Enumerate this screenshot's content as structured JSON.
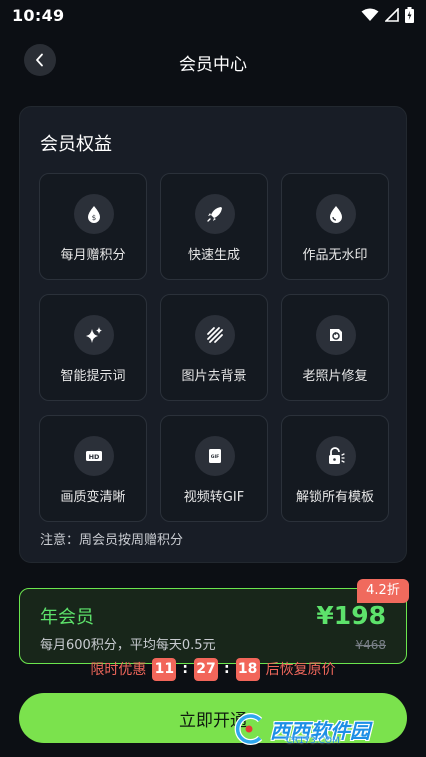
{
  "status_bar": {
    "time": "10:49"
  },
  "header": {
    "title": "会员中心"
  },
  "benefits": {
    "title": "会员权益",
    "items": [
      {
        "label": "每月赠积分",
        "icon": "coin-drop-icon"
      },
      {
        "label": "快速生成",
        "icon": "rocket-icon"
      },
      {
        "label": "作品无水印",
        "icon": "water-drop-icon"
      },
      {
        "label": "智能提示词",
        "icon": "sparkle-icon"
      },
      {
        "label": "图片去背景",
        "icon": "stripes-icon"
      },
      {
        "label": "老照片修复",
        "icon": "photo-restore-icon"
      },
      {
        "label": "画质变清晰",
        "icon": "hd-icon"
      },
      {
        "label": "视频转GIF",
        "icon": "gif-icon"
      },
      {
        "label": "解锁所有模板",
        "icon": "unlock-icon"
      }
    ],
    "note": "注意：周会员按周赠积分"
  },
  "plan": {
    "name": "年会员",
    "desc": "每月600积分，平均每天0.5元",
    "price": "¥198",
    "original_price": "¥468",
    "discount": "4.2折"
  },
  "countdown": {
    "prefix": "限时优惠",
    "hours": "11",
    "minutes": "27",
    "seconds": "18",
    "suffix": "后恢复原价"
  },
  "cta": {
    "label": "立即开通"
  },
  "watermark": {
    "text": "西西软件园",
    "sub": "CR173.COM"
  },
  "colors": {
    "accent": "#7be24d",
    "price": "#5de26b",
    "countdown": "#f0675b",
    "background": "#0c0f14"
  }
}
